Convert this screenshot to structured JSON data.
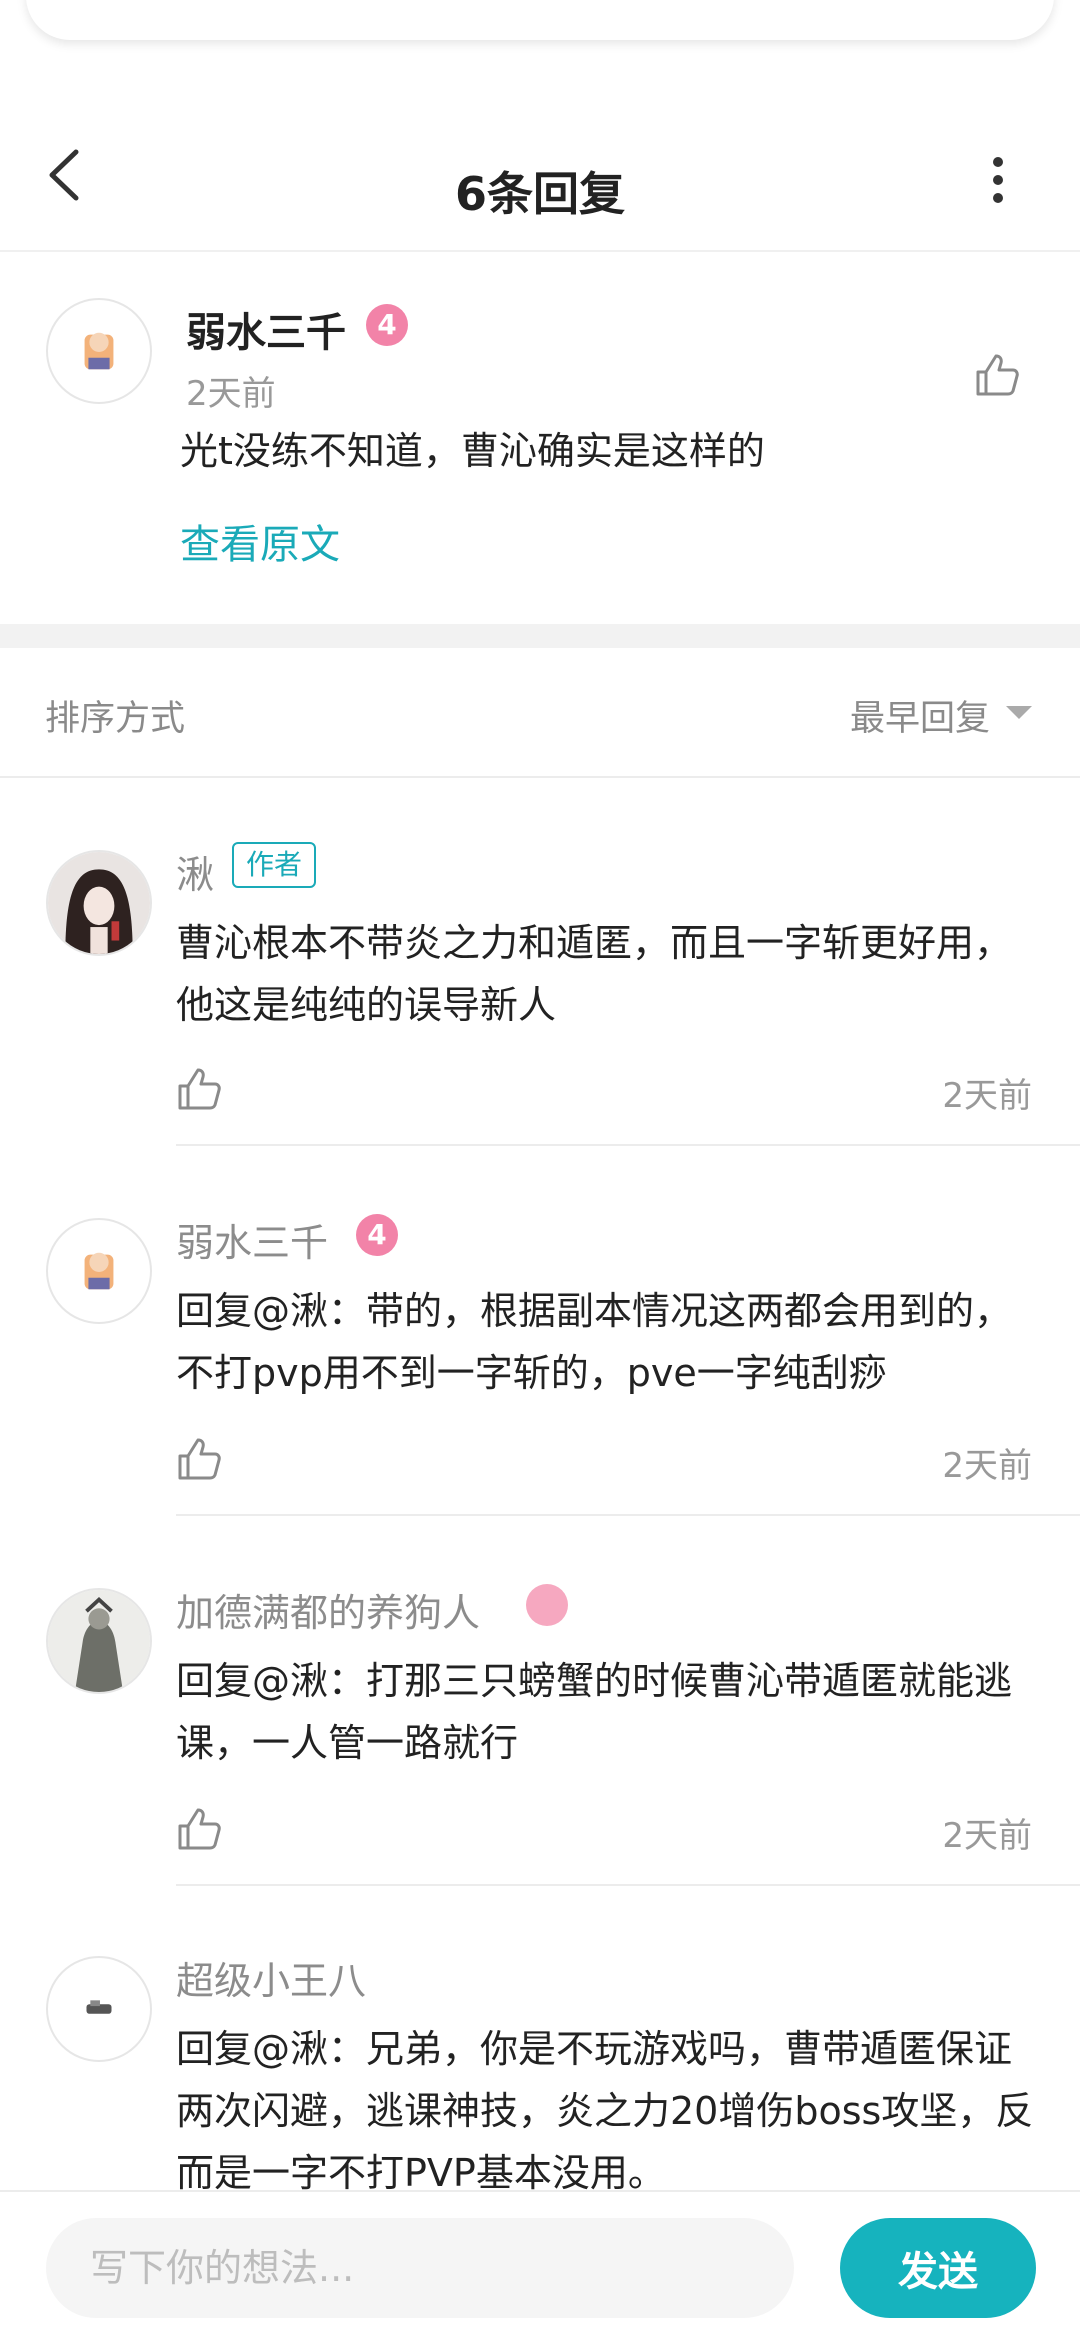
{
  "header": {
    "title": "6条回复"
  },
  "original_comment": {
    "username": "弱水三千",
    "level": "4",
    "time": "2天前",
    "text": "光t没练不知道，曹沁确实是这样的",
    "view_original_label": "查看原文"
  },
  "sort": {
    "label": "排序方式",
    "value": "最早回复"
  },
  "replies": [
    {
      "username": "湫",
      "tag": "作者",
      "text": "曹沁根本不带炎之力和遁匿，而且一字斩更好用，他这是纯纯的误导新人",
      "time": "2天前"
    },
    {
      "username": "弱水三千",
      "level": "4",
      "text": "回复@湫：带的，根据副本情况这两都会用到的，不打pvp用不到一字斩的，pve一字纯刮痧",
      "time": "2天前"
    },
    {
      "username": "加德满都的养狗人",
      "text": "回复@湫：打那三只螃蟹的时候曹沁带遁匿就能逃课，一人管一路就行",
      "time": "2天前"
    },
    {
      "username": "超级小王八",
      "text": "回复@湫：兄弟，你是不玩游戏吗，曹带遁匿保证两次闪避，逃课神技，炎之力20增伤boss攻坚，反而是一字不打PVP基本没用。"
    }
  ],
  "input": {
    "placeholder": "写下你的想法...",
    "send_label": "发送"
  },
  "colors": {
    "accent": "#16b3be",
    "level_badge": "#f283a8",
    "text": "#222222",
    "muted": "#999999"
  },
  "icons": [
    "back-icon",
    "more-icon",
    "like-icon",
    "sort-caret-icon"
  ]
}
